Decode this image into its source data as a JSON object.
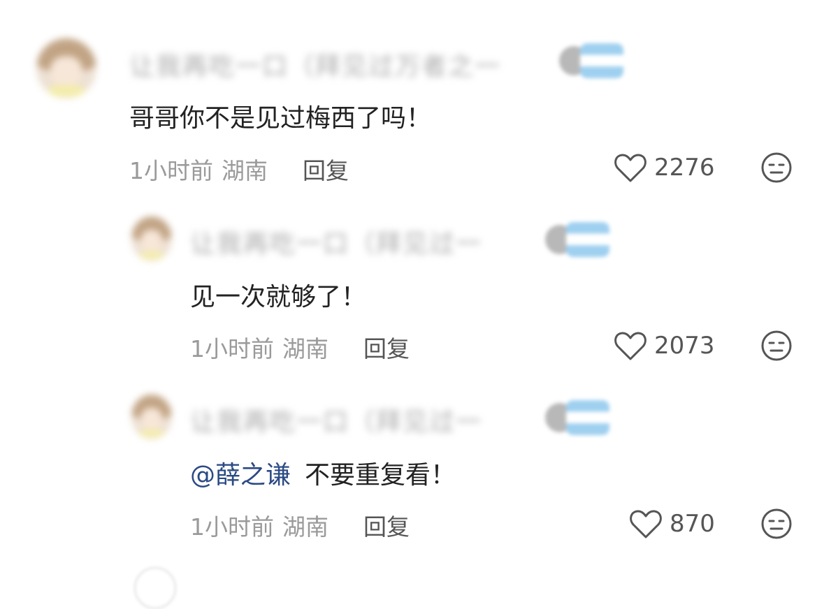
{
  "comments": [
    {
      "username": "让我再吃一口（拜见过万者之一",
      "text": "哥哥你不是见过梅西了吗！",
      "time": "1小时前",
      "location": "湖南",
      "reply_label": "回复",
      "likes": "2276"
    },
    {
      "username": "让我再吃一口（拜见过一",
      "text": "见一次就够了！",
      "time": "1小时前",
      "location": "湖南",
      "reply_label": "回复",
      "likes": "2073"
    },
    {
      "username": "让我再吃一口（拜见过一",
      "mention": "@薛之谦",
      "text": "不要重复看！",
      "time": "1小时前",
      "location": "湖南",
      "reply_label": "回复",
      "likes": "870"
    }
  ],
  "icons": {
    "like": "heart-outline-icon",
    "dislike": "neutral-face-icon"
  },
  "colors": {
    "mention": "#2b4a84",
    "meta": "#9a9a9a",
    "text": "#222222"
  }
}
